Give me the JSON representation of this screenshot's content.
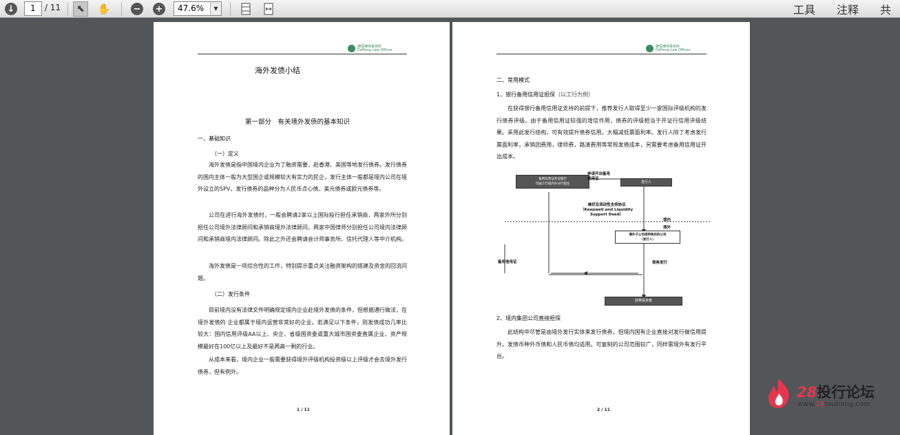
{
  "toolbar": {
    "current_page": "1",
    "total_pages": "/ 11",
    "zoom": "47.6%",
    "tools_label": "工具",
    "comment_label": "注释",
    "share_label": "共享"
  },
  "page1": {
    "logo_name": "德恒律师事务所",
    "logo_sub": "DeHeng Law Offices",
    "doc_title": "海外发债小结",
    "part_title": "第一部分　有关境外发债的基本知识",
    "section1": "一、基础知识",
    "sub1": "（一）定义",
    "p1": "海外发债是指中国境内企业为了融资需要，赴香港、美国等地发行债券。发行债券的国内主体一般为大型国企或规模较大有实力的民企，发行主体一般都是境内公司在境外设立的SPV，发行债券的品种分为人民币点心债、美元债券或欧元债券等。",
    "p2": "公司在进行海外发债时，一般会聘请2家以上国际投行担任承销商，两家外所分别担任公司境外法律顾问和承销商境外法律顾问，两家中国律师分别担任公司境内法律顾问和承销商境内法律顾问。除此之外还会聘请会计师事务所、信托代理人等中介机构。",
    "p3": "海外发债是一项综合性的工作，特别提示重点关注融资架构的搭建及资金的回流问题。",
    "sub2": "（二）发行条件",
    "p4": "目前境内没有法律文件明确规定境内企业赴境外发债的条件，但根据通行做法，在境外发债的 企业都属于境内运营非常好的企业。若满足以下条件，则发债成功几率比较大：国内信用评级AA以上、央企、省级国资委或重大城市国资委直属企业、资产规模最好在100亿以上及最好不是两高一剩的行业。",
    "p5": "从成本来看，境内企业一般需要获得境外评级机构投资级以上评级才会去境外发行债券，但有例外。",
    "footer": "1 / 11"
  },
  "page2": {
    "logo_name": "德恒律师事务所",
    "logo_sub": "DeHeng Law Offices",
    "section2": "二、常用模式",
    "mode1_title": "1、银行备用信用证担保",
    "mode1_note": "（以工行为例）",
    "p1": "在获得银行备用信用证支持的前提下，推荐发行人取得至少一家国际评级机构的发行债券评级。由于备用信用证较强的增信作用，债券的评级相当于开证行信用评级结果。采用此发行结构，可有效提升债券信用，大幅减低票面利率。发行人除了考虑发行票面利率，承销团费用，律师费，路演费用等常规发债成本，另需要考虑备用信用证开出成本。",
    "diagram": {
      "box_bank": "备用信用证开证银行\n可由工行境内外分行担任",
      "box_issuer": "发行人",
      "box_sub": "境外子公司或特殊目的公司\n（发行人）",
      "box_investor": "债券投资者",
      "label_apply": "申请开出备用\n信用证",
      "label_keepwell": "维好及流动性支持协议\n（Keepwell and Liquidity\nSupport Deed）",
      "label_domestic": "境内",
      "label_overseas": "境外",
      "label_sblc": "备用信用证",
      "label_bond": "债券发行"
    },
    "mode2_title": "2、境内集团公司直接担保",
    "p2": "此结构中尽管是由境外发行实体来发行债券，但境内国有企业直接对发行做信用提升。发债币种外币债和人民币债均适用。可复制的公司范围较广，同样需境外有发行平台。",
    "footer": "2 / 11"
  },
  "watermark": {
    "title_num": "28",
    "title_text": "投行论坛",
    "url_pre": "www.",
    "url_hl": "28",
    "url_post": "touhang.com"
  }
}
